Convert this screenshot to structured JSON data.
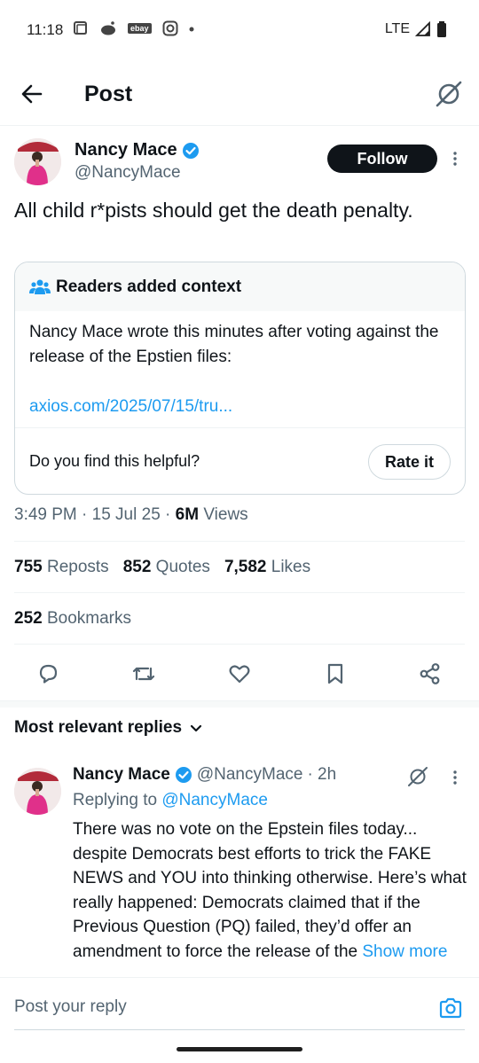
{
  "status_bar": {
    "time": "11:18",
    "network": "LTE",
    "notif_badges": [
      "ebay"
    ]
  },
  "header": {
    "title": "Post"
  },
  "post": {
    "author_name": "Nancy Mace",
    "author_handle": "@NancyMace",
    "follow_label": "Follow",
    "text": "All child r*pists should get the death penalty.",
    "context": {
      "heading": "Readers added context",
      "body": "Nancy Mace wrote this minutes after voting against the release of the Epstien files:",
      "link": "axios.com/2025/07/15/tru...",
      "question": "Do you find this helpful?",
      "rate_label": "Rate it"
    },
    "timestamp": "3:49 PM · 15 Jul 25 · ",
    "views_count": "6M",
    "views_label": " Views",
    "stats": {
      "reposts_count": "755",
      "reposts_label": "Reposts",
      "quotes_count": "852",
      "quotes_label": "Quotes",
      "likes_count": "7,582",
      "likes_label": "Likes",
      "bookmarks_count": "252",
      "bookmarks_label": "Bookmarks"
    }
  },
  "replies": {
    "sort_label": "Most relevant replies",
    "items": [
      {
        "author_name": "Nancy Mace",
        "author_handle": "@NancyMace",
        "time": "· 2h",
        "replying_label": "Replying to ",
        "replying_handle": "@NancyMace",
        "text": "There was no vote on the Epstein files today... despite Democrats best efforts to trick the FAKE NEWS and YOU into thinking otherwise. Here’s what really happened: Democrats claimed that if the Previous Question (PQ) failed, they’d offer an amendment to force the release of the ",
        "show_more": "Show more"
      }
    ]
  },
  "composer": {
    "placeholder": "Post your reply"
  },
  "colors": {
    "accent": "#1d9bf0",
    "text": "#0f1419",
    "secondary": "#536471",
    "verified": "#1d9bf0"
  }
}
